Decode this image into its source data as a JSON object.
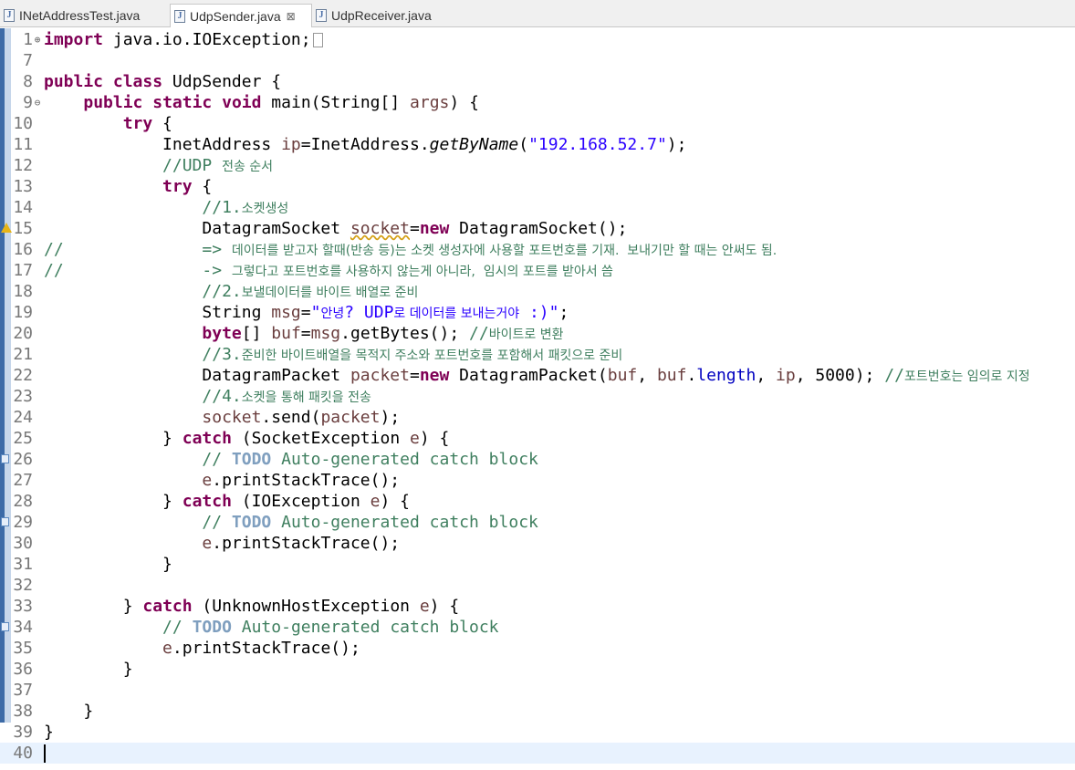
{
  "tabs": [
    {
      "label": "INetAddressTest.java",
      "active": false
    },
    {
      "label": "UdpSender.java",
      "active": true,
      "close": "⊠"
    },
    {
      "label": "UdpReceiver.java",
      "active": false
    }
  ],
  "editor": {
    "lines": [
      {
        "n": "1",
        "fold": "⊕"
      },
      {
        "n": "7"
      },
      {
        "n": "8"
      },
      {
        "n": "9",
        "fold": "⊖"
      },
      {
        "n": "10"
      },
      {
        "n": "11"
      },
      {
        "n": "12"
      },
      {
        "n": "13"
      },
      {
        "n": "14"
      },
      {
        "n": "15",
        "marker": "warning-icon"
      },
      {
        "n": "16"
      },
      {
        "n": "17"
      },
      {
        "n": "18"
      },
      {
        "n": "19"
      },
      {
        "n": "20"
      },
      {
        "n": "21"
      },
      {
        "n": "22"
      },
      {
        "n": "23"
      },
      {
        "n": "24"
      },
      {
        "n": "25"
      },
      {
        "n": "26",
        "marker": "task-icon"
      },
      {
        "n": "27"
      },
      {
        "n": "28"
      },
      {
        "n": "29",
        "marker": "task-icon"
      },
      {
        "n": "30"
      },
      {
        "n": "31"
      },
      {
        "n": "32"
      },
      {
        "n": "33"
      },
      {
        "n": "34",
        "marker": "task-icon"
      },
      {
        "n": "35"
      },
      {
        "n": "36"
      },
      {
        "n": "37"
      },
      {
        "n": "38"
      },
      {
        "n": "39"
      },
      {
        "n": "40",
        "current": true
      }
    ],
    "code": {
      "l1_kw": "import",
      "l1_rest": " java.io.IOException;",
      "l8_kw1": "public",
      "l8_kw2": "class",
      "l8_rest": " UdpSender {",
      "l9_kw1": "public",
      "l9_kw2": "static",
      "l9_kw3": "void",
      "l9_rest1": " main(String[] ",
      "l9_param": "args",
      "l9_rest2": ") {",
      "l10_kw": "try",
      "l10_rest": " {",
      "l11_a": "InetAddress ",
      "l11_var": "ip",
      "l11_b": "=InetAddress.",
      "l11_method": "getByName",
      "l11_c": "(",
      "l11_str": "\"192.168.52.7\"",
      "l11_d": ");",
      "l12_c1": "//UDP ",
      "l12_c2": "전송 순서",
      "l13_kw": "try",
      "l13_rest": " {",
      "l14_c1": "//1.",
      "l14_c2": "소켓생성",
      "l15_a": "DatagramSocket ",
      "l15_var": "socket",
      "l15_b": "=",
      "l15_kw": "new",
      "l15_c": " DatagramSocket();",
      "l16_c1": "//              => ",
      "l16_c2": "데이터를 받고자 할때(반송 등)는 소켓 생성자에 사용할 포트번호를 기재.  보내기만 할 때는 안써도 됨.",
      "l17_c1": "//              -> ",
      "l17_c2": "그렇다고 포트번호를 사용하지 않는게 아니라,  임시의 포트를 받아서 씀",
      "l18_c1": "//2.",
      "l18_c2": "보낼데이터를 바이트 배열로 준비",
      "l19_a": "String ",
      "l19_var": "msg",
      "l19_b": "=",
      "l19_s1": "\"",
      "l19_s2": "안녕",
      "l19_s3": "? UDP",
      "l19_s4": "로 데이터를 보내는거야",
      "l19_s5": " :)\"",
      "l19_c": ";",
      "l20_kw": "byte",
      "l20_a": "[] ",
      "l20_var1": "buf",
      "l20_b": "=",
      "l20_var2": "msg",
      "l20_c": ".getBytes(); ",
      "l20_c1": "//",
      "l20_c2": "바이트로 변환",
      "l21_c1": "//3.",
      "l21_c2": "준비한 바이트배열을 목적지 주소와 포트번호를 포함해서 패킷으로 준비",
      "l22_a": "DatagramPacket ",
      "l22_var1": "packet",
      "l22_b": "=",
      "l22_kw": "new",
      "l22_c": " DatagramPacket(",
      "l22_var2": "buf",
      "l22_d": ", ",
      "l22_var3": "buf",
      "l22_e": ".",
      "l22_field": "length",
      "l22_f": ", ",
      "l22_var4": "ip",
      "l22_g": ", 5000); ",
      "l22_c1": "//",
      "l22_c2": "포트번호는 임의로 지정",
      "l23_c1": "//4.",
      "l23_c2": "소켓을 통해 패킷을 전송",
      "l24_var1": "socket",
      "l24_a": ".send(",
      "l24_var2": "packet",
      "l24_b": ");",
      "l25_a": "} ",
      "l25_kw": "catch",
      "l25_b": " (SocketException ",
      "l25_var": "e",
      "l25_c": ") {",
      "todo_pre": "// ",
      "todo_word": "TODO",
      "todo_post": " Auto-generated catch block",
      "print_var": "e",
      "print_rest": ".printStackTrace();",
      "l28_a": "} ",
      "l28_kw": "catch",
      "l28_b": " (IOException ",
      "l28_var": "e",
      "l28_c": ") {",
      "close_brace": "}",
      "l33_a": "} ",
      "l33_kw": "catch",
      "l33_b": " (UnknownHostException ",
      "l33_var": "e",
      "l33_c": ") {"
    }
  }
}
